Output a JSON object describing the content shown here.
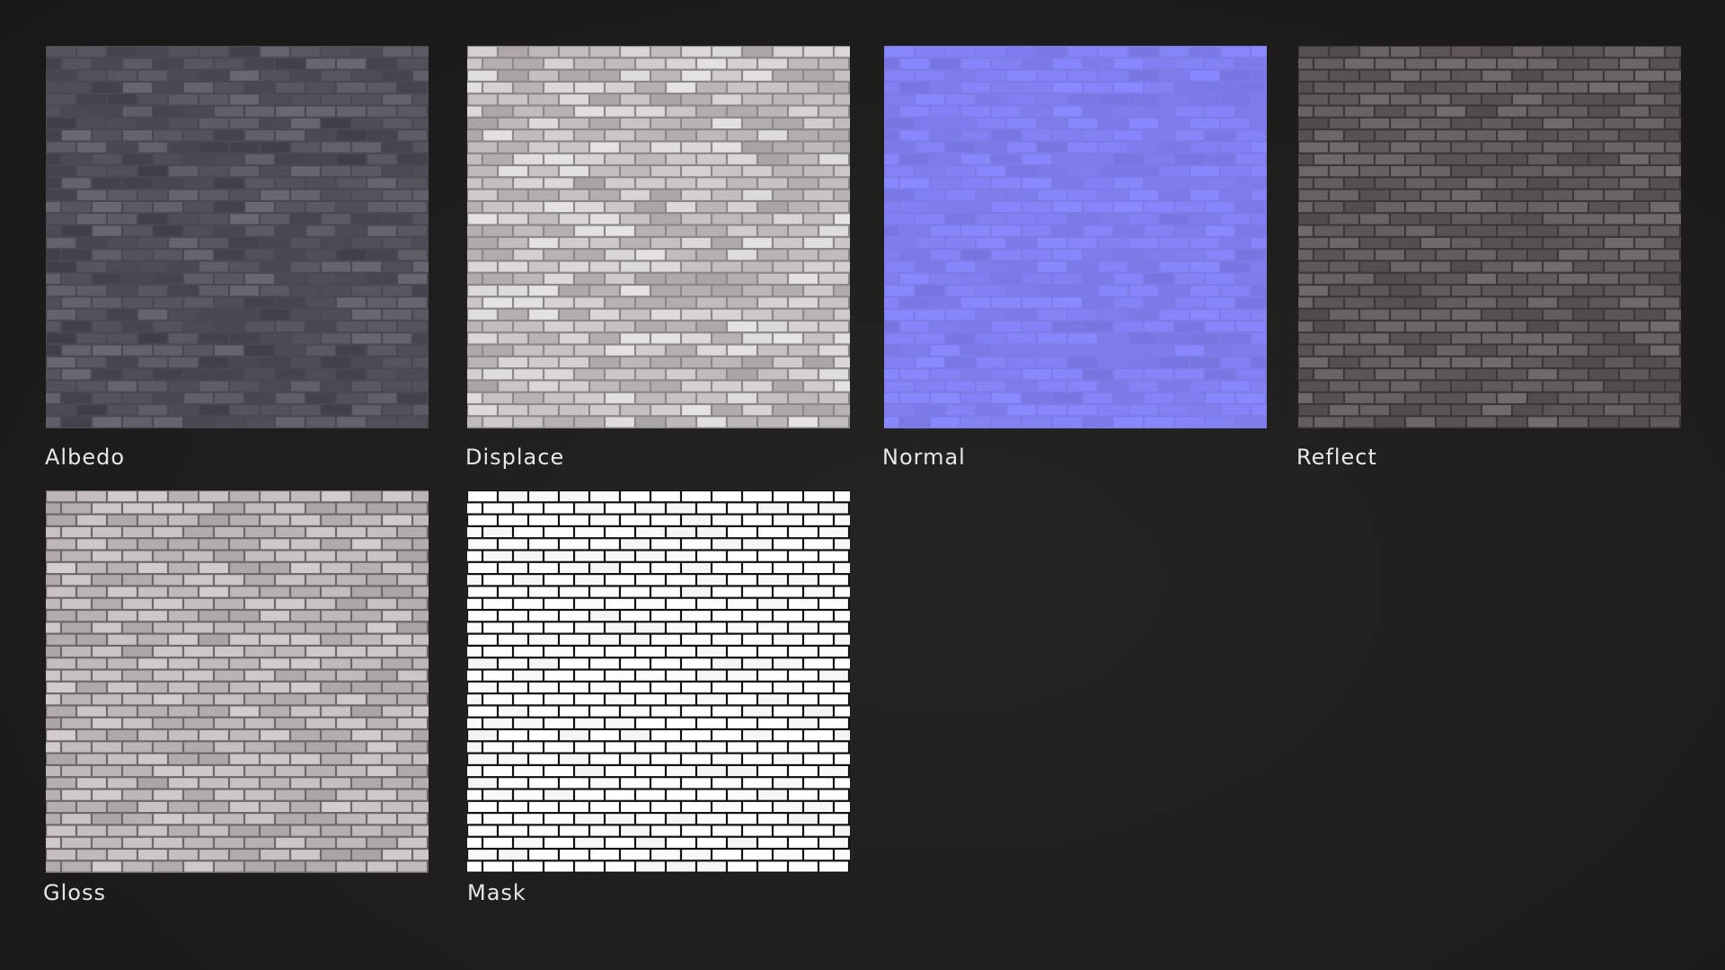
{
  "maps": [
    {
      "key": "albedo",
      "label": "Albedo",
      "base": "#55535c",
      "mortar": "#4a4951",
      "light": "#6a6872",
      "dark": "#403f47",
      "icon": "albedo-texture"
    },
    {
      "key": "displace",
      "label": "Displace",
      "base": "#c9c4c4",
      "mortar": "#8d8888",
      "light": "#e6e3e3",
      "dark": "#a9a3a3",
      "icon": "displacement-texture"
    },
    {
      "key": "normal",
      "label": "Normal",
      "base": "#8280f2",
      "mortar": "#7d7ce6",
      "light": "#8b89ff",
      "dark": "#7775e0",
      "icon": "normal-map-texture"
    },
    {
      "key": "reflect",
      "label": "Reflect",
      "base": "#625c5c",
      "mortar": "#3d3838",
      "light": "#736c6c",
      "dark": "#514b4b",
      "icon": "reflection-texture"
    },
    {
      "key": "gloss",
      "label": "Gloss",
      "base": "#c2bcbc",
      "mortar": "#6e6969",
      "light": "#d3cdcd",
      "dark": "#aaa4a4",
      "icon": "gloss-texture"
    },
    {
      "key": "mask",
      "label": "Mask",
      "base": "#ffffff",
      "mortar": "#111111",
      "light": "#ffffff",
      "dark": "#f4f4f4",
      "icon": "mask-texture"
    }
  ]
}
